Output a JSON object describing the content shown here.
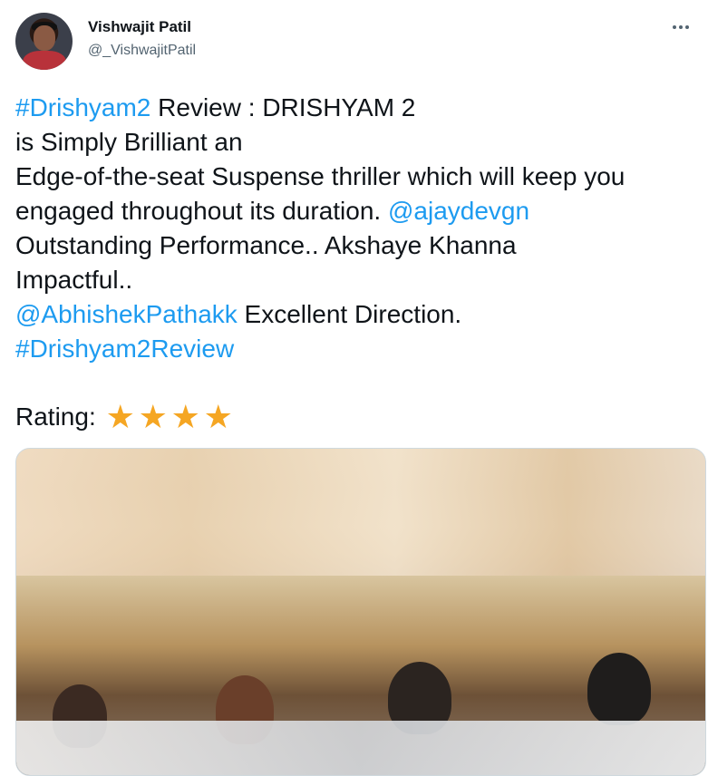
{
  "user": {
    "display_name": "Vishwajit Patil",
    "handle": "@_VishwajitPatil"
  },
  "icons": {
    "more": "more-horizontal-icon",
    "star": "star-icon"
  },
  "colors": {
    "link": "#1d9bf0",
    "text": "#0f1419",
    "muted": "#536471",
    "star": "#f5a623",
    "border": "#cfd9de"
  },
  "tweet": {
    "line1_hashtag": "#Drishyam2",
    "line1_rest": " Review : DRISHYAM 2",
    "line2": "is Simply Brilliant an",
    "line3": "Edge-of-the-seat Suspense thriller which will keep you",
    "line4_text": "engaged throughout its duration. ",
    "line4_mention": "@ajaydevgn",
    "line5": "Outstanding Performance.. Akshaye Khanna",
    "line6": "Impactful..",
    "line7_mention": "@AbhishekPathakk",
    "line7_rest": " Excellent Direction.",
    "line8_hashtag": "#Drishyam2Review",
    "rating_label": "Rating:",
    "rating_stars": 4,
    "star_glyph": "★"
  }
}
